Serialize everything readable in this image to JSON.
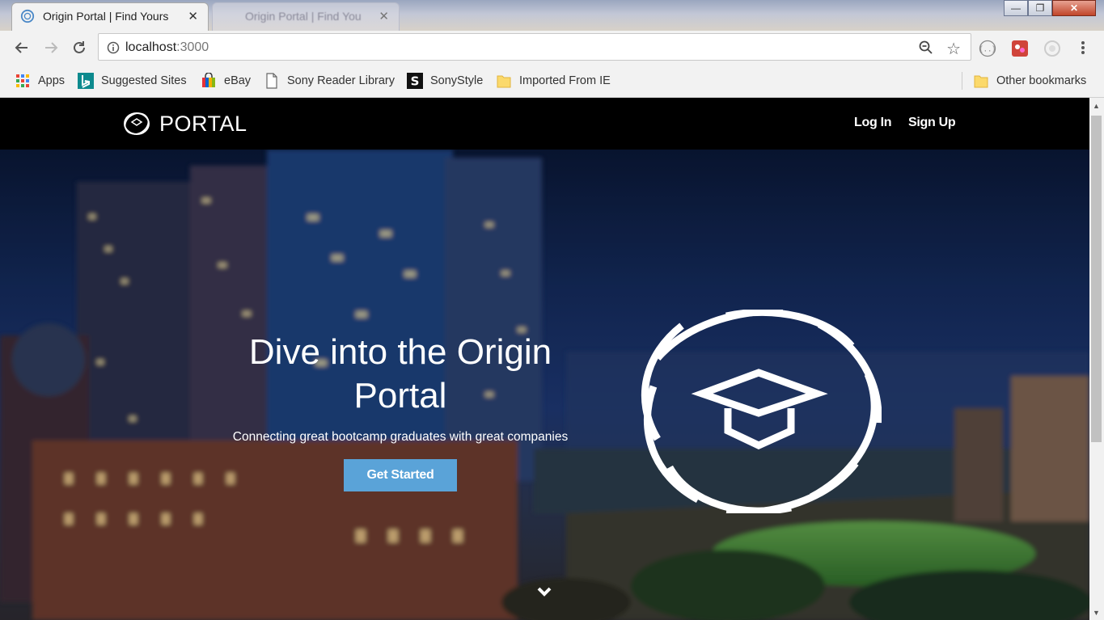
{
  "browser": {
    "tabs": [
      {
        "title": "Origin Portal | Find Yours",
        "active": true
      },
      {
        "title": "Origin Portal | Find You",
        "active": false
      }
    ],
    "url_host": "localhost",
    "url_port": ":3000",
    "window_controls": {
      "minimize": "—",
      "maximize": "❐",
      "close": "✕"
    },
    "bookmarks": [
      {
        "label": "Apps",
        "icon": "apps-grid-icon"
      },
      {
        "label": "Suggested Sites",
        "icon": "bing-icon"
      },
      {
        "label": "eBay",
        "icon": "ebay-bag-icon"
      },
      {
        "label": "Sony Reader Library",
        "icon": "page-icon"
      },
      {
        "label": "SonyStyle",
        "icon": "sonystyle-icon"
      },
      {
        "label": "Imported From IE",
        "icon": "folder-icon"
      }
    ],
    "other_bookmarks": "Other bookmarks"
  },
  "site": {
    "brand": "PORTAL",
    "nav": {
      "login": "Log In",
      "signup": "Sign Up"
    },
    "hero": {
      "title": "Dive into the Origin Portal",
      "subtitle": "Connecting great bootcamp graduates with great companies",
      "cta": "Get Started"
    }
  },
  "colors": {
    "navbar": "#000000",
    "cta": "#5aa3d8",
    "chrome": "#f2f2f2"
  }
}
